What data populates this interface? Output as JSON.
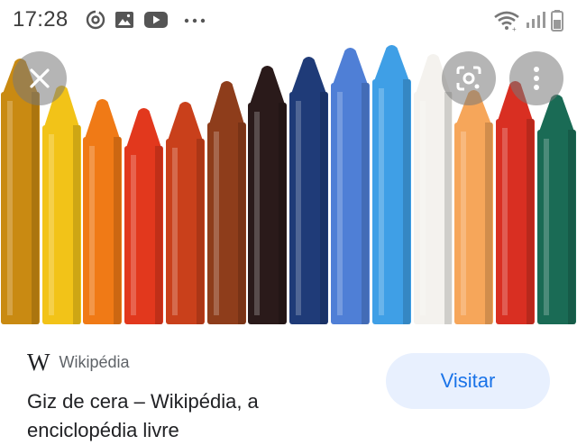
{
  "status_bar": {
    "time": "17:28",
    "left_icons": [
      "sync-icon",
      "image-icon",
      "youtube-icon",
      "more-dots-icon"
    ],
    "right_icons": [
      "wifi-icon",
      "signal-icon",
      "battery-icon"
    ]
  },
  "image": {
    "subject": "crayons",
    "crayon_colors": [
      "#c98a12",
      "#f2c318",
      "#f07a16",
      "#e2381d",
      "#c9401b",
      "#8e3d1b",
      "#2a1a1a",
      "#1f3b78",
      "#4f7fd6",
      "#3f9fe6",
      "#f4f2ee",
      "#f6a65a",
      "#d92f22",
      "#1a6b55"
    ],
    "close_icon": "close-icon",
    "lens_icon": "lens-icon",
    "menu_icon": "more-vert-icon"
  },
  "card": {
    "source_logo": "W",
    "source_name": "Wikipédia",
    "title": "Giz de cera – Wikipédia, a enciclopédia livre",
    "visit_label": "Visitar"
  },
  "colors": {
    "accent": "#1a73e8",
    "button_bg": "#e8f0fe",
    "text_primary": "#202124",
    "text_secondary": "#5f6368"
  }
}
